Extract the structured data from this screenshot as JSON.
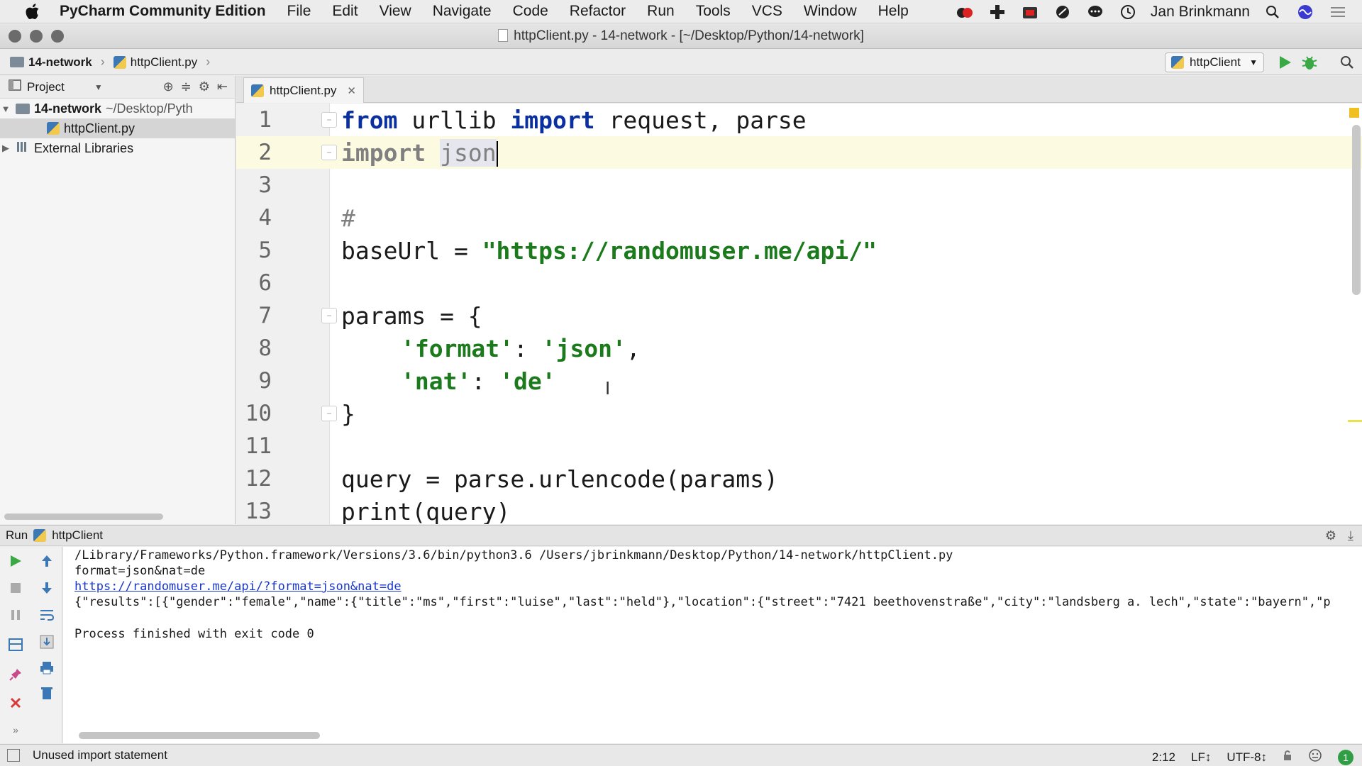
{
  "menubar": {
    "app_name": "PyCharm Community Edition",
    "items": [
      "File",
      "Edit",
      "View",
      "Navigate",
      "Code",
      "Refactor",
      "Run",
      "Tools",
      "VCS",
      "Window",
      "Help"
    ],
    "user": "Jan Brinkmann"
  },
  "window": {
    "title": "httpClient.py - 14-network - [~/Desktop/Python/14-network]"
  },
  "navbar": {
    "project": "14-network",
    "file": "httpClient.py",
    "run_config": "httpClient"
  },
  "project_panel": {
    "header": "Project",
    "tree": [
      {
        "label": "14-network",
        "hint": "~/Desktop/Pyth",
        "type": "folder",
        "expanded": true
      },
      {
        "label": "httpClient.py",
        "type": "python-file",
        "selected": true
      },
      {
        "label": "External Libraries",
        "type": "library",
        "expanded": false
      }
    ]
  },
  "editor": {
    "tab": "httpClient.py",
    "line_numbers": [
      "1",
      "2",
      "3",
      "4",
      "5",
      "6",
      "7",
      "8",
      "9",
      "10",
      "11",
      "12",
      "13"
    ],
    "lines": {
      "l1_kw1": "from",
      "l1_mod": " urllib ",
      "l1_kw2": "import",
      "l1_rest": " request, parse",
      "l2_kw": "import",
      "l2_name": "json",
      "l4_comment": "#",
      "l5_var": "baseUrl = ",
      "l5_str": "\"https://randomuser.me/api/\"",
      "l7": "params = {",
      "l8_key": "'format'",
      "l8_sep": ": ",
      "l8_val": "'json'",
      "l8_end": ",",
      "l9_key": "'nat'",
      "l9_sep": ": ",
      "l9_val": "'de'",
      "l10": "}",
      "l12": "query = parse.urlencode(params)",
      "l13": "print(query)"
    }
  },
  "run_window": {
    "label": "Run",
    "config": "httpClient",
    "output": [
      "/Library/Frameworks/Python.framework/Versions/3.6/bin/python3.6 /Users/jbrinkmann/Desktop/Python/14-network/httpClient.py",
      "format=json&nat=de",
      "https://randomuser.me/api/?format=json&nat=de",
      "{\"results\":[{\"gender\":\"female\",\"name\":{\"title\":\"ms\",\"first\":\"luise\",\"last\":\"held\"},\"location\":{\"street\":\"7421 beethovenstraße\",\"city\":\"landsberg a. lech\",\"state\":\"bayern\",\"p",
      "",
      "Process finished with exit code 0"
    ]
  },
  "statusbar": {
    "message": "Unused import statement",
    "position": "2:12",
    "line_sep": "LF↕",
    "encoding": "UTF-8↕",
    "notifications": "1"
  },
  "colors": {
    "keyword": "#0a2fa0",
    "string": "#1b7a1b",
    "current_line": "#fcfae0",
    "link": "#1a37c8"
  }
}
